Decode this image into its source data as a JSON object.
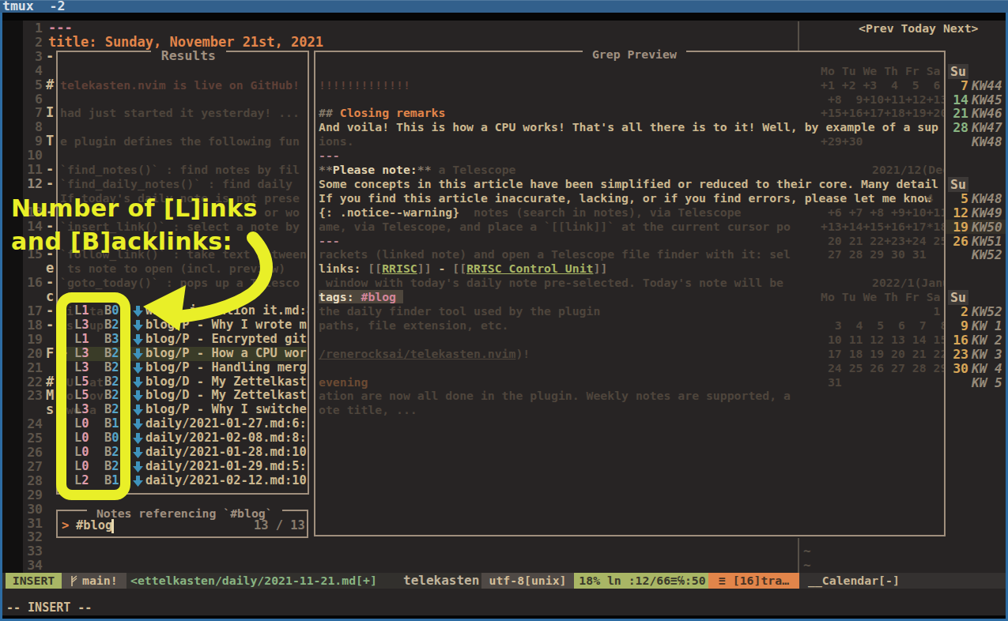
{
  "window": {
    "title": "tmux  -2"
  },
  "editor": {
    "rows": [
      {
        "row": 0,
        "num": "1",
        "text": "---",
        "cls": "c-pink"
      },
      {
        "row": 1,
        "num": "2",
        "text": "title: Sunday, November 21st, 2021",
        "cls": "c-orange"
      },
      {
        "row": 2,
        "num": "3",
        "frag": "-"
      },
      {
        "row": 3,
        "num": "4"
      },
      {
        "row": 4,
        "num": "5",
        "frag": "#"
      },
      {
        "row": 5,
        "num": "6"
      },
      {
        "row": 6,
        "num": "7",
        "frag": "I"
      },
      {
        "row": 7,
        "num": "8"
      },
      {
        "row": 8,
        "num": "9",
        "frag": "T"
      },
      {
        "row": 9,
        "num": "10"
      },
      {
        "row": 10,
        "num": "11",
        "frag": "-"
      },
      {
        "row": 11,
        "num": "12",
        "cur": true,
        "frag": "-"
      },
      {
        "row": 12,
        "num": ""
      },
      {
        "row": 13,
        "num": "13",
        "frag": "-"
      },
      {
        "row": 14,
        "num": "14",
        "frag": "-"
      },
      {
        "row": 15,
        "num": ""
      },
      {
        "row": 16,
        "num": "15",
        "frag": "-"
      },
      {
        "row": 17,
        "num": "",
        "frag": "e"
      },
      {
        "row": 18,
        "num": "16",
        "frag": "-"
      },
      {
        "row": 19,
        "num": "",
        "frag": "c"
      },
      {
        "row": 20,
        "num": "17",
        "frag": "-"
      },
      {
        "row": 21,
        "num": "18",
        "frag": "-"
      },
      {
        "row": 22,
        "num": "19"
      },
      {
        "row": 23,
        "num": "20",
        "frag": "F"
      },
      {
        "row": 24,
        "num": "21"
      },
      {
        "row": 25,
        "num": "22",
        "frag": "#"
      },
      {
        "row": 26,
        "num": "23",
        "frag": "M"
      },
      {
        "row": 27,
        "num": "",
        "frag": "s"
      },
      {
        "row": 28,
        "num": "24"
      },
      {
        "row": 29,
        "num": "25"
      },
      {
        "row": 30,
        "num": "26"
      },
      {
        "row": 31,
        "num": "27"
      },
      {
        "row": 32,
        "num": "28"
      },
      {
        "row": 33,
        "num": "29"
      },
      {
        "row": 34,
        "num": "30"
      },
      {
        "row": 35,
        "num": "31"
      },
      {
        "row": 36,
        "num": "32"
      },
      {
        "row": 37,
        "num": "33"
      },
      {
        "row": 38,
        "num": "34"
      }
    ],
    "tildes": [
      {
        "row": 37,
        "text": "~"
      },
      {
        "row": 38,
        "text": "~"
      }
    ]
  },
  "results_panel": {
    "title": " Results ",
    "dim_rows": [
      {
        "row": 4,
        "text": "telekasten.nvim is live on GitHub!",
        "cls": "dim-red"
      },
      {
        "row": 6,
        "text": "had just started it yesterday! ..."
      },
      {
        "row": 8,
        "text": "e plugin defines the following fun"
      },
      {
        "row": 10,
        "text": "`find_notes()` : find notes by fil"
      },
      {
        "row": 11,
        "text": "`find_daily_notes()` : find daily"
      },
      {
        "row": 12,
        "text": "If today's daily note is not prese"
      },
      {
        "row": 13,
        "text": "                             or wo"
      },
      {
        "row": 14,
        "text": "`insert_link()` : select a note by"
      },
      {
        "row": 16,
        "text": "`follow_link()` : take text between"
      },
      {
        "row": 17,
        "text": " ts note to open (incl. preview)"
      },
      {
        "row": 18,
        "text": "`goto_today()` : pops up a Telesco"
      }
    ],
    "items": [
      {
        "row": 20,
        "l": "L1",
        "b": "B0",
        "file": "where i mention it.md:8:",
        "pre": "i",
        "mid": "ta"
      },
      {
        "row": 21,
        "l": "L3",
        "b": "B2",
        "file": "blog/P - Why I wrote m",
        "pre": "s",
        "mid": "up"
      },
      {
        "row": 22,
        "l": "L1",
        "b": "B3",
        "file": "blog/P - Encrypted git"
      },
      {
        "row": 23,
        "l": "L3",
        "b": "B2",
        "file": "blog/P - How a CPU wor",
        "selected": true,
        "caret": ">"
      },
      {
        "row": 24,
        "l": "L3",
        "b": "B2",
        "file": "blog/P - Handling merg"
      },
      {
        "row": 25,
        "l": "L5",
        "b": "B2",
        "file": "blog/D - My Zettelkast",
        "pre": "U",
        "mid": "at"
      },
      {
        "row": 26,
        "l": "L5",
        "b": "B2",
        "file": "blog/D - My Zettelkast",
        "pre": "o",
        "mid": "ov"
      },
      {
        "row": 27,
        "l": "L3",
        "b": "B2",
        "file": "blog/P - Why I switche",
        "pre": "we",
        "mid": "a"
      },
      {
        "row": 28,
        "l": "L0",
        "b": "B1",
        "file": "daily/2021-01-27.md:6:"
      },
      {
        "row": 29,
        "l": "L0",
        "b": "B0",
        "file": "daily/2021-02-08.md:8:"
      },
      {
        "row": 30,
        "l": "L0",
        "b": "B2",
        "file": "daily/2021-01-28.md:10"
      },
      {
        "row": 31,
        "l": "L0",
        "b": "B2",
        "file": "daily/2021-01-29.md:5:"
      },
      {
        "row": 32,
        "l": "L2",
        "b": "B1",
        "file": "daily/2021-02-12.md:10"
      }
    ]
  },
  "prompt_panel": {
    "title": " Notes referencing `#blog` ",
    "prefix": ">",
    "query": "#blog",
    "count": "13 / 13"
  },
  "preview_panel": {
    "title": " Grep Preview ",
    "rows": [
      {
        "row": 4,
        "segs": [
          {
            "t": "!!!!!!!!!!!!!",
            "c": "p-dimred"
          }
        ]
      },
      {
        "row": 6,
        "segs": [
          {
            "t": "## ",
            "c": "p-grey"
          },
          {
            "t": "Closing remarks",
            "c": "p-orangeb"
          }
        ]
      },
      {
        "row": 7,
        "segs": [
          {
            "t": "And voila! This is how a CPU works! That's all there is to it! Well, by example of a sup"
          }
        ]
      },
      {
        "row": 8,
        "segs": [
          {
            "t": "ions.",
            "c": "p-dim"
          }
        ]
      },
      {
        "row": 9,
        "segs": [
          {
            "t": "---",
            "c": "p-pink"
          }
        ]
      },
      {
        "row": 10,
        "segs": [
          {
            "t": "**",
            "c": "p-grey"
          },
          {
            "t": "Please note:",
            "c": "p-cream"
          },
          {
            "t": "**",
            "c": "p-grey"
          },
          {
            "t": " a Telescope",
            "c": "p-dim"
          }
        ]
      },
      {
        "row": 11,
        "segs": [
          {
            "t": "Some concepts in this article have been simplified or reduced to their core. Many detail"
          }
        ]
      },
      {
        "row": 12,
        "segs": [
          {
            "t": "If you find this article inaccurate, lacking, or if you find errors, please let me know"
          }
        ]
      },
      {
        "row": 13,
        "segs": [
          {
            "t": "{: .notice--warning}"
          },
          {
            "t": "  notes (search in notes), via Telescope",
            "c": "p-dim"
          }
        ]
      },
      {
        "row": 14,
        "segs": [
          {
            "t": "ame, via Telescope, and place a `[[link]]` at the current cursor po",
            "c": "p-dim"
          }
        ]
      },
      {
        "row": 15,
        "segs": [
          {
            "t": "---",
            "c": "p-pink"
          }
        ]
      },
      {
        "row": 16,
        "segs": [
          {
            "t": "rackets (linked note) and open a Telescope file finder with it: sel",
            "c": "p-dim"
          }
        ]
      },
      {
        "row": 17,
        "segs": [
          {
            "t": "links: "
          },
          {
            "t": "[[",
            "c": "p-grey"
          },
          {
            "t": "RRISC",
            "c": "p-green"
          },
          {
            "t": "]]",
            "c": "p-grey"
          },
          {
            "t": " - "
          },
          {
            "t": "[[",
            "c": "p-grey"
          },
          {
            "t": "RRISC Control Unit",
            "c": "p-green"
          },
          {
            "t": "]]",
            "c": "p-grey"
          }
        ]
      },
      {
        "row": 18,
        "segs": [
          {
            "t": " window with today's daily note pre-selected. Today's note will be",
            "c": "p-dim"
          }
        ]
      },
      {
        "row": 19,
        "segs": [
          {
            "t": "tags:",
            "c": "p-chip p-chip-t"
          },
          {
            "t": " ",
            "c": "p-chip"
          },
          {
            "t": "#blog",
            "c": "p-chip p-chip-p"
          },
          {
            "t": " ",
            "c": "p-chip"
          }
        ]
      },
      {
        "row": 20,
        "segs": [
          {
            "t": "the daily finder tool used by the plugin",
            "c": "p-dim"
          }
        ]
      },
      {
        "row": 21,
        "segs": [
          {
            "t": "paths, file extension, etc.",
            "c": "p-dim"
          }
        ]
      },
      {
        "row": 23,
        "segs": [
          {
            "t": "/renerocksai/telekasten.nvim",
            "c": "p-dim p-dimul"
          },
          {
            "t": ")!",
            "c": "p-dim"
          }
        ]
      },
      {
        "row": 25,
        "segs": [
          {
            "t": "evening",
            "c": "p-dimorange"
          }
        ]
      },
      {
        "row": 26,
        "segs": [
          {
            "t": "ation are now all done in the plugin. Weekly notes are supported, a",
            "c": "p-dim"
          }
        ]
      },
      {
        "row": 27,
        "segs": [
          {
            "t": "ote title, ...",
            "c": "p-dim"
          }
        ]
      }
    ]
  },
  "calendar": {
    "nav": "<Prev Today Next>",
    "sunday_header": "Su",
    "sunday_header_rows": [
      3,
      11,
      19
    ],
    "weeks": [
      {
        "row": 4,
        "day": "7",
        "kw": "KW44",
        "color": "yellow"
      },
      {
        "row": 5,
        "day": "14",
        "kw": "KW45",
        "color": "aqua"
      },
      {
        "row": 6,
        "day": "21",
        "kw": "KW46",
        "color": "aqua"
      },
      {
        "row": 7,
        "day": "28",
        "kw": "KW47",
        "color": "aqua"
      },
      {
        "row": 8,
        "day": "",
        "kw": "KW48"
      },
      {
        "row": 12,
        "day": "5",
        "kw": "KW48",
        "color": "yellow"
      },
      {
        "row": 13,
        "day": "12",
        "kw": "KW49",
        "color": "yellow"
      },
      {
        "row": 14,
        "day": "19",
        "kw": "KW50",
        "color": "yellow",
        "hl": true
      },
      {
        "row": 15,
        "day": "26",
        "kw": "KW51",
        "color": "yellow"
      },
      {
        "row": 16,
        "day": "",
        "kw": "KW52"
      },
      {
        "row": 20,
        "day": "2",
        "kw": "KW52",
        "color": "yellow"
      },
      {
        "row": 21,
        "day": "9",
        "kw": "KW 1",
        "color": "yellow"
      },
      {
        "row": 22,
        "day": "16",
        "kw": "KW 2",
        "color": "yellow"
      },
      {
        "row": 23,
        "day": "23",
        "kw": "KW 3",
        "color": "yellow"
      },
      {
        "row": 24,
        "day": "30",
        "kw": "KW 4",
        "color": "yellow"
      },
      {
        "row": 25,
        "day": "",
        "kw": "KW 5"
      }
    ],
    "dim_rows": [
      {
        "row": 3,
        "text": "Mo Tu We Th Fr Sa"
      },
      {
        "row": 4,
        "text": "+1 +2 +3  4  5  6"
      },
      {
        "row": 5,
        "text": " +8  9+10+11+12+13"
      },
      {
        "row": 6,
        "text": "+15+16+17+18+19+20"
      },
      {
        "row": 8,
        "text": "+29+30"
      },
      {
        "row": 10,
        "text": "2021/12(Dec",
        "month": true
      },
      {
        "row": 12,
        "text": "               4"
      },
      {
        "row": 13,
        "text": " +6 +7 +8 +9+10+11"
      },
      {
        "row": 14,
        "text": "+13+14+15+16+17*18"
      },
      {
        "row": 15,
        "text": " 20 21 22+23+24 25"
      },
      {
        "row": 16,
        "text": " 27 28 29 30 31"
      },
      {
        "row": 18,
        "text": "2022/1(Janu",
        "month": true
      },
      {
        "row": 19,
        "text": "Mo Tu We Th Fr Sa"
      },
      {
        "row": 20,
        "text": "                1"
      },
      {
        "row": 21,
        "text": "  3  4  5  6  7  8"
      },
      {
        "row": 22,
        "text": " 10 11 12 13 14 15"
      },
      {
        "row": 23,
        "text": " 17 18 19 20 21 22"
      },
      {
        "row": 24,
        "text": " 24 25 26 27 28 29"
      },
      {
        "row": 25,
        "text": " 31"
      }
    ]
  },
  "statusline": {
    "mode": "INSERT",
    "git_branch": "main!",
    "file_path": "<ettelkasten/daily/2021-11-21.md[+]",
    "plugin": "telekasten",
    "encoding": "utf-8[unix]",
    "position": "18% ln :12/66≡℅:50",
    "tabs": "≡ [16]tra…",
    "calendar_status": "__Calendar[-]"
  },
  "cmdline": {
    "mode_text": "-- INSERT --"
  },
  "annotation": {
    "line1": "Number of [L]inks",
    "line2": "and [B]acklinks:",
    "color": "#e9ef28"
  },
  "colors": {
    "bg": "#272424",
    "fg": "#d2bc96",
    "orange": "#e2854a",
    "pink": "#d3869b",
    "green": "#a9b665",
    "aqua": "#89b482",
    "yellow": "#d8a657",
    "blue_arrow": "#3f93bd",
    "border": "#a08f7d",
    "dim": "#4e453c",
    "annotation_yellow": "#e9ef28",
    "titlebar_blue": "#32608c",
    "frame_blue": "#2d6ca3"
  }
}
